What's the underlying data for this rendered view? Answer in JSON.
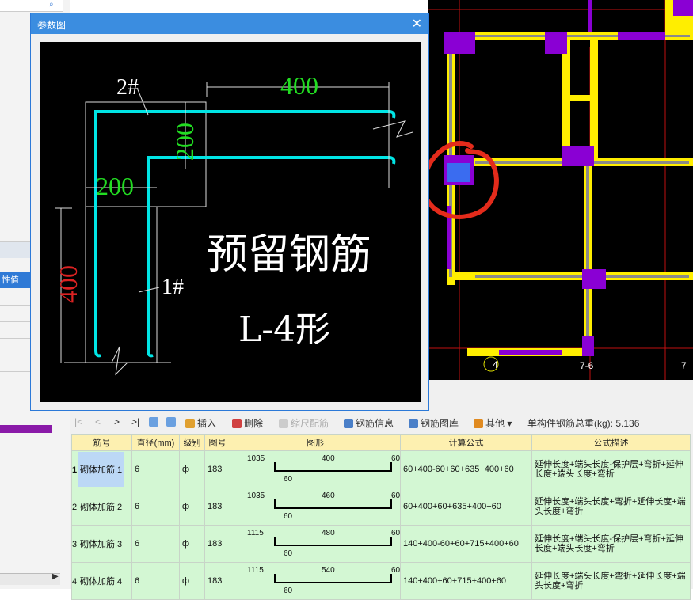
{
  "dialog": {
    "title": "参数图",
    "close": "✕"
  },
  "diagram": {
    "bar2_label": "2#",
    "bar1_label": "1#",
    "dim_top": "400",
    "dim_side": "200",
    "dim_inner": "200",
    "dim_left": "400",
    "title_cn": "预留钢筋",
    "subtitle": "L-4形"
  },
  "cad": {
    "axis_labels": [
      "4",
      "7-6",
      "7"
    ]
  },
  "left_panel": {
    "header": "性值"
  },
  "toolbar": {
    "nav": [
      "|<",
      "<",
      ">",
      ">|"
    ],
    "insert": "插入",
    "delete": "删除",
    "ruler": "缩尺配筋",
    "info": "钢筋信息",
    "library": "钢筋图库",
    "other": "其他",
    "total_label": "单构件钢筋总重(kg): 5.136"
  },
  "table": {
    "headers": [
      "筋号",
      "直径(mm)",
      "级别",
      "图号",
      "图形",
      "计算公式",
      "公式描述"
    ],
    "rows": [
      {
        "num": "1",
        "name": "砌体加筋.1",
        "dia": "6",
        "grade": "ф",
        "fig": "183",
        "left": "1035",
        "mid": "400",
        "right": "60",
        "bot": "60",
        "formula": "60+400-60+60+635+400+60",
        "desc": "延伸长度+端头长度-保护层+弯折+延伸长度+端头长度+弯折"
      },
      {
        "num": "2",
        "name": "砌体加筋.2",
        "dia": "6",
        "grade": "ф",
        "fig": "183",
        "left": "1035",
        "mid": "460",
        "right": "60",
        "bot": "60",
        "formula": "60+400+60+635+400+60",
        "desc": "延伸长度+端头长度+弯折+延伸长度+端头长度+弯折"
      },
      {
        "num": "3",
        "name": "砌体加筋.3",
        "dia": "6",
        "grade": "ф",
        "fig": "183",
        "left": "1115",
        "mid": "480",
        "right": "60",
        "bot": "60",
        "formula": "140+400-60+60+715+400+60",
        "desc": "延伸长度+端头长度-保护层+弯折+延伸长度+端头长度+弯折"
      },
      {
        "num": "4",
        "name": "砌体加筋.4",
        "dia": "6",
        "grade": "ф",
        "fig": "183",
        "left": "1115",
        "mid": "540",
        "right": "60",
        "bot": "60",
        "formula": "140+400+60+715+400+60",
        "desc": "延伸长度+端头长度+弯折+延伸长度+端头长度+弯折"
      }
    ]
  },
  "colors": {
    "wall": "#ffee00",
    "column": "#8a00d4",
    "bar": "#00e5e5",
    "dim_green": "#22dd22",
    "dim_red": "#dd2222",
    "highlight": "#e32b1b"
  }
}
